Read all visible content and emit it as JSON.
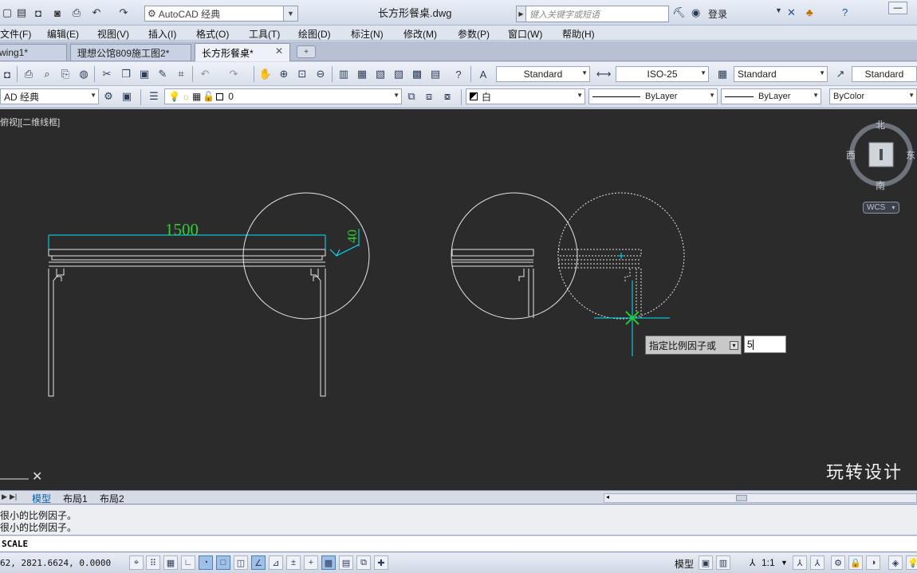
{
  "titlebar": {
    "workspace": "AutoCAD 经典",
    "doc_title": "长方形餐桌.dwg",
    "search_placeholder": "键入关键字或短语",
    "login": "登录"
  },
  "menu": [
    "文件(F)",
    "编辑(E)",
    "视图(V)",
    "插入(I)",
    "格式(O)",
    "工具(T)",
    "绘图(D)",
    "标注(N)",
    "修改(M)",
    "参数(P)",
    "窗口(W)",
    "帮助(H)"
  ],
  "doc_tabs": [
    {
      "label": "wing1*"
    },
    {
      "label": "理想公馆809施工图2*"
    },
    {
      "label": "长方形餐桌*"
    }
  ],
  "toolbar": {
    "text_style": "Standard",
    "dim_style": "ISO-25",
    "table_style": "Standard",
    "mleader_style": "Standard",
    "workspace2": "AD 经典",
    "layer": "0",
    "color": "白",
    "linetype": "ByLayer",
    "lineweight": "ByLayer",
    "plotstyle": "ByColor"
  },
  "canvas": {
    "view_label": "俯视][二维线框]",
    "dim_text": "1500",
    "dim_text_small": "40",
    "compass": {
      "north": "北",
      "south": "南",
      "east": "东",
      "west": "西"
    },
    "wcs_label": "WCS",
    "watermark": "玩转设计",
    "dynamic_prompt": "指定比例因子或",
    "dynamic_value": "5"
  },
  "layout_tabs": [
    "模型",
    "布局1",
    "布局2"
  ],
  "command": {
    "history": [
      "很小的比例因子。",
      "很小的比例因子。"
    ],
    "current": "SCALE"
  },
  "status": {
    "coordinates": "62, 2821.6624, 0.0000",
    "model": "模型",
    "annotation_scale": "1:1"
  },
  "colors": {
    "canvas_bg": "#2b2b2b",
    "dimension": "#00ffff",
    "dim_text": "#33cc33"
  }
}
